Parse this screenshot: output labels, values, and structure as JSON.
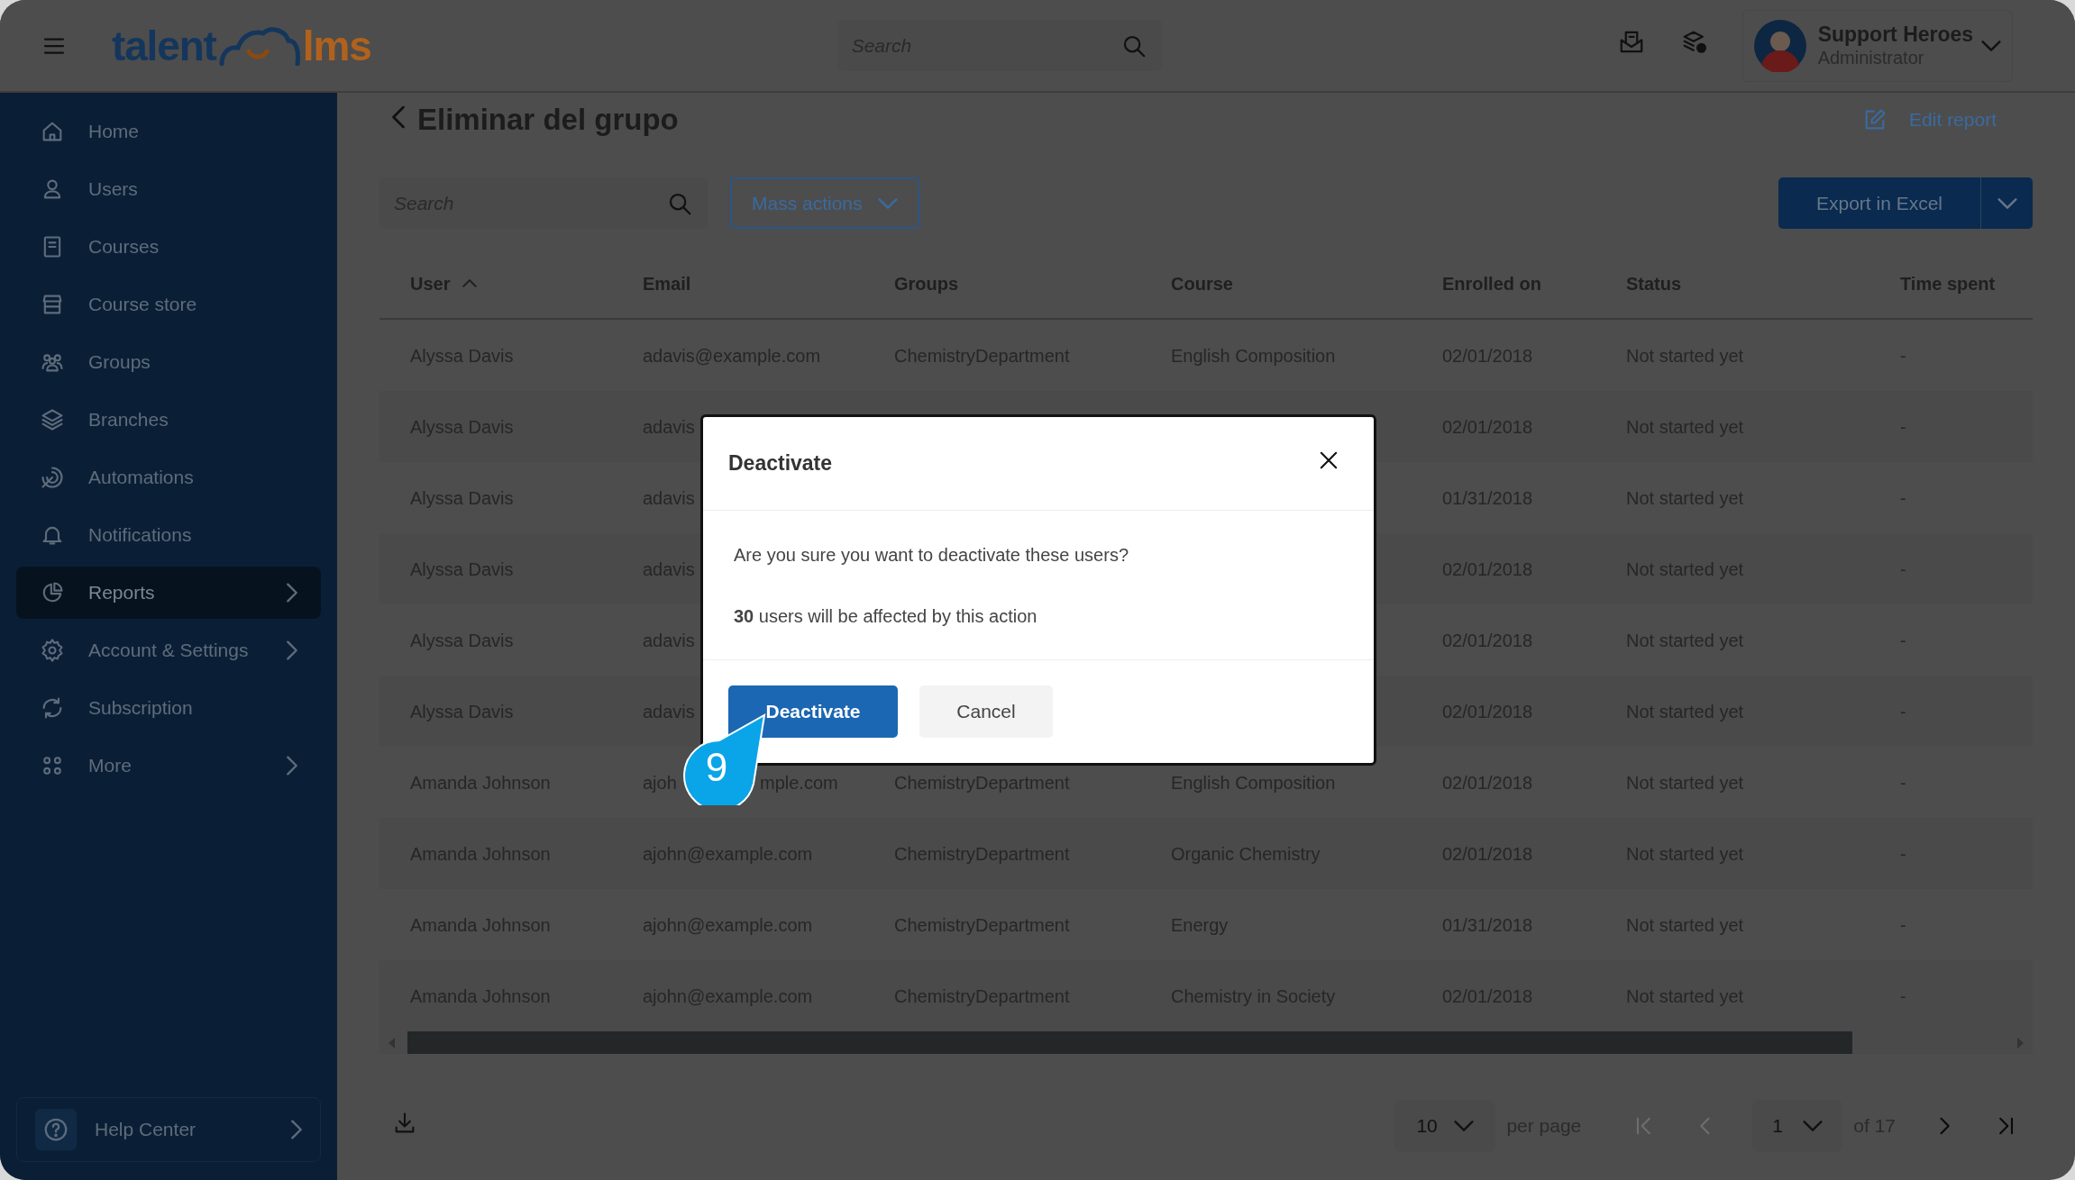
{
  "top_bar": {
    "logo": {
      "part_1": "talent",
      "part_2": "lms"
    },
    "search": {
      "placeholder": "Search"
    },
    "user": {
      "name": "Support Heroes",
      "role": "Administrator"
    }
  },
  "sidebar": {
    "items": [
      {
        "label": "Home",
        "selected": false,
        "has_submenu": false
      },
      {
        "label": "Users",
        "selected": false,
        "has_submenu": false
      },
      {
        "label": "Courses",
        "selected": false,
        "has_submenu": false
      },
      {
        "label": "Course store",
        "selected": false,
        "has_submenu": false
      },
      {
        "label": "Groups",
        "selected": false,
        "has_submenu": false
      },
      {
        "label": "Branches",
        "selected": false,
        "has_submenu": false
      },
      {
        "label": "Automations",
        "selected": false,
        "has_submenu": false
      },
      {
        "label": "Notifications",
        "selected": false,
        "has_submenu": false
      },
      {
        "label": "Reports",
        "selected": true,
        "has_submenu": true
      },
      {
        "label": "Account & Settings",
        "selected": false,
        "has_submenu": true
      },
      {
        "label": "Subscription",
        "selected": false,
        "has_submenu": false
      },
      {
        "label": "More",
        "selected": false,
        "has_submenu": true
      }
    ],
    "help": {
      "label": "Help Center"
    }
  },
  "page": {
    "title": "Eliminar del grupo",
    "edit_link": "Edit report",
    "search": {
      "placeholder": "Search"
    },
    "mass_actions": "Mass actions",
    "export_button": "Export in Excel"
  },
  "table": {
    "columns": [
      {
        "label": "User",
        "sorted": true
      },
      {
        "label": "Email",
        "sorted": false
      },
      {
        "label": "Groups",
        "sorted": false
      },
      {
        "label": "Course",
        "sorted": false
      },
      {
        "label": "Enrolled on",
        "sorted": false
      },
      {
        "label": "Status",
        "sorted": false
      },
      {
        "label": "Time spent",
        "sorted": false
      }
    ],
    "rows": [
      {
        "user": "Alyssa Davis",
        "email": "adavis@example.com",
        "groups": "ChemistryDepartment",
        "course": "English Composition",
        "enrolled": "02/01/2018",
        "status": "Not started yet",
        "time": "-"
      },
      {
        "user": "Alyssa Davis",
        "email": "adavis",
        "enrolled": "02/01/2018",
        "status": "Not started yet",
        "time": "-"
      },
      {
        "user": "Alyssa Davis",
        "email": "adavis",
        "enrolled": "01/31/2018",
        "status": "Not started yet",
        "time": "-"
      },
      {
        "user": "Alyssa Davis",
        "email": "adavis",
        "enrolled": "02/01/2018",
        "status": "Not started yet",
        "time": "-"
      },
      {
        "user": "Alyssa Davis",
        "email": "adavis",
        "enrolled": "02/01/2018",
        "status": "Not started yet",
        "time": "-"
      },
      {
        "user": "Alyssa Davis",
        "email": "adavis",
        "enrolled": "02/01/2018",
        "status": "Not started yet",
        "time": "-"
      },
      {
        "user": "Amanda Johnson",
        "email": "ajoh",
        "email_end": "mple.com",
        "groups": "ChemistryDepartment",
        "course": "English Composition",
        "enrolled": "02/01/2018",
        "status": "Not started yet",
        "time": "-"
      },
      {
        "user": "Amanda Johnson",
        "email": "ajohn@example.com",
        "groups": "ChemistryDepartment",
        "course": "Organic Chemistry",
        "enrolled": "02/01/2018",
        "status": "Not started yet",
        "time": "-"
      },
      {
        "user": "Amanda Johnson",
        "email": "ajohn@example.com",
        "groups": "ChemistryDepartment",
        "course": "Energy",
        "enrolled": "01/31/2018",
        "status": "Not started yet",
        "time": "-"
      },
      {
        "user": "Amanda Johnson",
        "email": "ajohn@example.com",
        "groups": "ChemistryDepartment",
        "course": "Chemistry in Society",
        "enrolled": "02/01/2018",
        "status": "Not started yet",
        "time": "-"
      }
    ]
  },
  "pagination": {
    "per_page": "10",
    "per_page_label": "per page",
    "page": "1",
    "total": "of 17",
    "nav": [
      {
        "kind": "first",
        "disabled": true
      },
      {
        "kind": "prev",
        "disabled": true
      },
      {
        "kind": "next",
        "disabled": false
      },
      {
        "kind": "last",
        "disabled": false
      }
    ]
  },
  "dialog": {
    "title": "Deactivate",
    "question": "Are you sure you want to deactivate these users?",
    "note": "**30** users will be affected by this action",
    "confirm": "Deactivate",
    "cancel": "Cancel"
  },
  "callout": {
    "number": "9"
  }
}
